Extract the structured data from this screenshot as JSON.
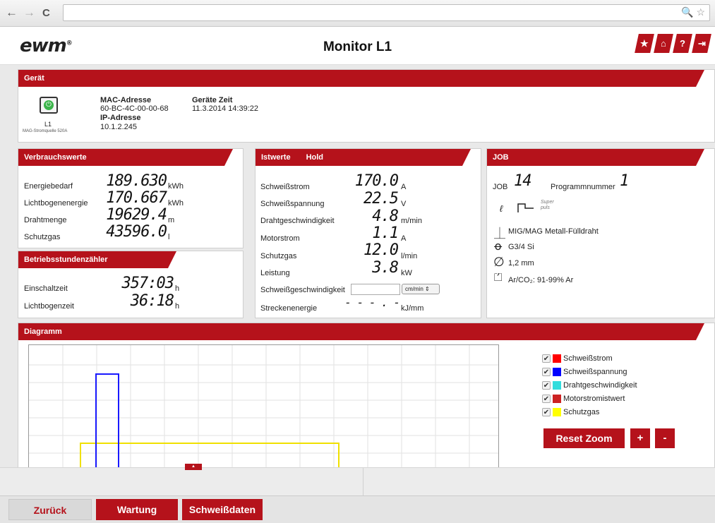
{
  "browser": {
    "back": "←",
    "forward": "→",
    "reload": "C",
    "zoom_icon": "🔍",
    "star_icon": "☆"
  },
  "header": {
    "logo": "ewm",
    "logo_mark": "®",
    "title": "Monitor L1",
    "buttons": [
      "★",
      "⌂",
      "?",
      "⇥"
    ]
  },
  "device": {
    "section_title": "Gerät",
    "name": "L1",
    "type": "MAG-Stromquelle 520A",
    "mac_label": "MAC-Adresse",
    "mac_value": "60-BC-4C-00-00-68",
    "ip_label": "IP-Adresse",
    "ip_value": "10.1.2.245",
    "time_label": "Geräte Zeit",
    "time_value": "11.3.2014 14:39:22"
  },
  "consumption": {
    "section_title": "Verbrauchswerte",
    "rows": [
      {
        "label": "Energiebedarf",
        "value": "189.630",
        "unit": "kWh"
      },
      {
        "label": "Lichtbogenenergie",
        "value": "170.667",
        "unit": "kWh"
      },
      {
        "label": "Drahtmenge",
        "value": "19629.4",
        "unit": "m"
      },
      {
        "label": "Schutzgas",
        "value": "43596.0",
        "unit": "l"
      }
    ]
  },
  "hours": {
    "section_title": "Betriebsstundenzähler",
    "rows": [
      {
        "label": "Einschaltzeit",
        "value": "357:03",
        "unit": "h"
      },
      {
        "label": "Lichtbogenzeit",
        "value": "36:18",
        "unit": "h"
      }
    ]
  },
  "actual": {
    "section_title": "Istwerte",
    "hold": "Hold",
    "rows": [
      {
        "label": "Schweißstrom",
        "value": "170.0",
        "unit": "A"
      },
      {
        "label": "Schweißspannung",
        "value": "22.5",
        "unit": "V"
      },
      {
        "label": "Drahtgeschwindigkeit",
        "value": "4.8",
        "unit": "m/min"
      },
      {
        "label": "Motorstrom",
        "value": "1.1",
        "unit": "A"
      },
      {
        "label": "Schutzgas",
        "value": "12.0",
        "unit": "l/min"
      },
      {
        "label": "Leistung",
        "value": "3.8",
        "unit": "kW"
      }
    ],
    "speed_label": "Schweißgeschwindigkeit",
    "speed_value": "",
    "speed_unit": "cm/min",
    "energy_label": "Streckenenergie",
    "energy_value": "- - - . -",
    "energy_unit": "kJ/mm"
  },
  "job": {
    "section_title": "JOB",
    "job_label": "JOB",
    "job_value": "14",
    "prog_label": "Programmnummer",
    "prog_value": "1",
    "superpuls": "Super puls",
    "process": "MIG/MAG Metall-Fülldraht",
    "wire": "G3/4 Si",
    "diameter": "1,2 mm",
    "gas": "Ar/CO₂: 91-99% Ar"
  },
  "diagram": {
    "section_title": "Diagramm",
    "legend": [
      {
        "label": "Schweißstrom",
        "color": "#ff0000"
      },
      {
        "label": "Schweißspannung",
        "color": "#0000ff"
      },
      {
        "label": "Drahtgeschwindigkeit",
        "color": "#33dddd"
      },
      {
        "label": "Motorstromistwert",
        "color": "#cc2222"
      },
      {
        "label": "Schutzgas",
        "color": "#ffff00"
      }
    ],
    "reset_zoom": "Reset Zoom",
    "zoom_in": "+",
    "zoom_out": "-",
    "collapse": "▲"
  },
  "footer": {
    "back": "Zurück",
    "maintenance": "Wartung",
    "weld_data": "Schweißdaten"
  },
  "colors": {
    "accent": "#b5121b"
  }
}
